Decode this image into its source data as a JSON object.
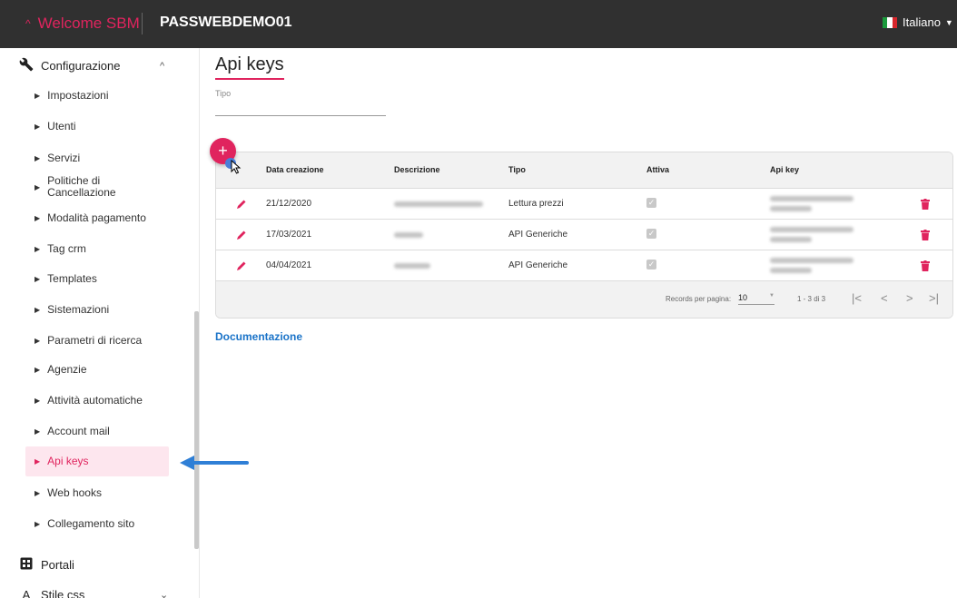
{
  "header": {
    "welcome_label": "Welcome SBM",
    "app_name": "PASSWEBDEMO01",
    "language_label": "Italiano",
    "brand_color": "#e0245e",
    "bar_color": "#303030"
  },
  "sidebar": {
    "section_configurazione": "Configurazione",
    "items": [
      {
        "label": "Impostazioni"
      },
      {
        "label": "Utenti"
      },
      {
        "label": "Servizi"
      },
      {
        "label": "Politiche di Cancellazione"
      },
      {
        "label": "Modalità pagamento"
      },
      {
        "label": "Tag crm"
      },
      {
        "label": "Templates"
      },
      {
        "label": "Sistemazioni"
      },
      {
        "label": "Parametri di ricerca"
      },
      {
        "label": "Agenzie"
      },
      {
        "label": "Attività automatiche"
      },
      {
        "label": "Account mail"
      },
      {
        "label": "Api keys",
        "active": true
      },
      {
        "label": "Web hooks"
      },
      {
        "label": "Collegamento sito"
      }
    ],
    "section_portali": "Portali",
    "section_stile": "Stile css"
  },
  "main": {
    "title": "Api keys",
    "filter_label": "Tipo",
    "table": {
      "columns": [
        "Data creazione",
        "Descrizione",
        "Tipo",
        "Attiva",
        "Api key"
      ],
      "rows": [
        {
          "date": "21/12/2020",
          "tipo": "Lettura prezzi",
          "attiva": true
        },
        {
          "date": "17/03/2021",
          "tipo": "API Generiche",
          "attiva": true
        },
        {
          "date": "04/04/2021",
          "tipo": "API Generiche",
          "attiva": true
        }
      ],
      "records_per_page_label": "Records per pagina:",
      "records_per_page_value": "10",
      "range_label": "1 - 3 di 3"
    },
    "doc_link": "Documentazione"
  },
  "icons": {
    "add": "plus-icon",
    "edit": "pencil-icon",
    "delete": "trash-icon",
    "config": "wrench-icon"
  }
}
